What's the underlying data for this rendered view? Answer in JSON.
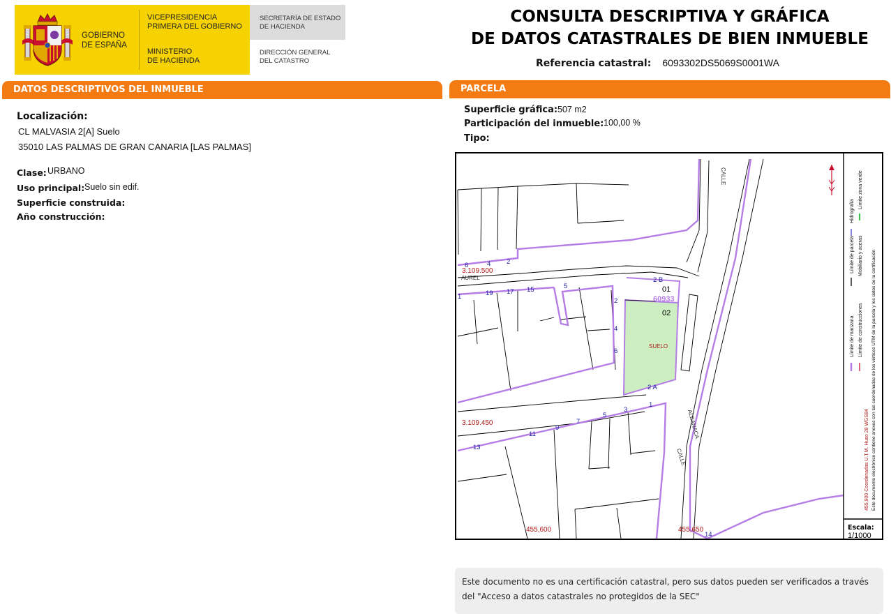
{
  "header": {
    "gobierno": [
      "GOBIERNO",
      "DE ESPAÑA"
    ],
    "vicepresidencia": [
      "VICEPRESIDENCIA",
      "PRIMERA DEL GOBIERNO"
    ],
    "ministerio": [
      "MINISTERIO",
      "DE HACIENDA"
    ],
    "secretaria": [
      "SECRETARÍA DE ESTADO",
      "DE HACIENDA"
    ],
    "direccion": [
      "DIRECCIÓN GENERAL",
      "DEL CATASTRO"
    ]
  },
  "title": {
    "line1": "CONSULTA DESCRIPTIVA Y GRÁFICA",
    "line2": "DE DATOS CATASTRALES DE BIEN INMUEBLE",
    "ref_label": "Referencia catastral:",
    "ref_value": "6093302DS5069S0001WA"
  },
  "descriptivos": {
    "header": "DATOS DESCRIPTIVOS DEL INMUEBLE",
    "localizacion_label": "Localización:",
    "localizacion_line1": "CL MALVASIA 2[A] Suelo",
    "localizacion_line2": "35010 LAS PALMAS DE GRAN CANARIA [LAS PALMAS]",
    "clase_label": "Clase:",
    "clase_value": "URBANO",
    "uso_label": "Uso principal:",
    "uso_value": "Suelo sin edif.",
    "superficie_label": "Superficie construida:",
    "anio_label": "Año construcción:"
  },
  "parcela": {
    "header": "PARCELA",
    "superficie_label": "Superficie gráfica:",
    "superficie_value": "507 m2",
    "participacion_label": "Participación del inmueble:",
    "participacion_value": "100,00 %",
    "tipo_label": "Tipo:"
  },
  "map": {
    "labels": {
      "y1": "3.109.500",
      "y2": "3.109.450",
      "x1": "455,600",
      "x2": "455,650",
      "parcel_ref": "60933",
      "unit_01": "01",
      "unit_02": "02",
      "suelo": "SUELO",
      "street_top": "CALLE",
      "street_aurel": "AUREL",
      "street_calle": "CALLE",
      "street_albanaca": "ALBANACA",
      "portal_2b": "2 B",
      "portal_2a": "2 A",
      "num_2": "2",
      "num_4": "4",
      "num_6": "6",
      "num_6b": "6",
      "num_4b": "4",
      "num_2b": "2",
      "num_19": "19",
      "num_17": "17",
      "num_15": "15",
      "num_5": "5",
      "num_1": "1",
      "num_13": "13",
      "num_11": "11",
      "num_9": "9",
      "num_7": "7",
      "num_5b": "5",
      "num_3": "3",
      "num_1b": "1",
      "num_14": "14"
    },
    "legend": {
      "limite_manzana": "Límite de manzana",
      "limite_parcela": "Límite de parcela",
      "hidrografia": "Hidrografía",
      "limite_construcciones": "Límite de construcciones",
      "mobiliario": "Mobiliario y aceras",
      "zona_verde": "Límite zona verde",
      "coords": "455,900 Coordenadas U.T.M. Huso 28 WGS84",
      "electronic": "Este documento electrónico contiene anexos con las coordenadas de los vértices UTM de la parcela y los datos de la certificación"
    },
    "scale_label": "Escala:",
    "scale_value": "1/1000",
    "colors": {
      "parcel_line": "#b57de6",
      "parcel_fill": "#cdeec1",
      "coord_text": "#b01818",
      "number_text": "#1a1aa0"
    }
  },
  "footer_note": "Este documento no es una certificación catastral, pero sus datos pueden ser verificados a través del \"Acceso a datos catastrales no protegidos de la SEC\""
}
